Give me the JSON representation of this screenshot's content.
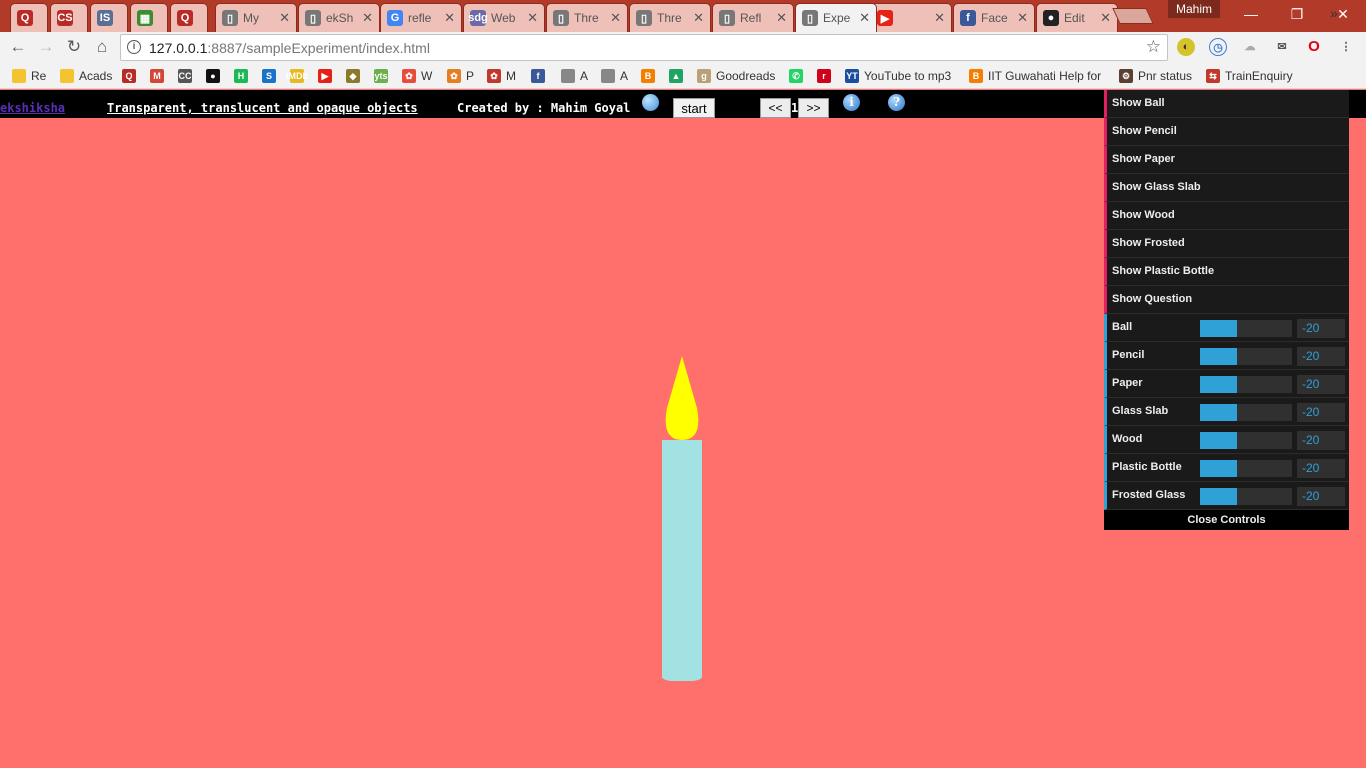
{
  "browser": {
    "tabs": [
      {
        "title": "",
        "icon": "quora-icon",
        "color": "#b92b27",
        "glyph": "Q"
      },
      {
        "title": "",
        "icon": "codechef-icon",
        "color": "#b92b27",
        "glyph": "CS"
      },
      {
        "title": "",
        "icon": "is-icon",
        "color": "#5b6f93",
        "glyph": "IS"
      },
      {
        "title": "",
        "icon": "grid-app-icon",
        "color": "#3c8d2f",
        "glyph": "▦"
      },
      {
        "title": "",
        "icon": "quora-icon",
        "color": "#b92b27",
        "glyph": "Q"
      },
      {
        "title": "My",
        "icon": "page-icon",
        "color": "#777777",
        "glyph": "▯"
      },
      {
        "title": "ekSh",
        "icon": "page-icon",
        "color": "#777777",
        "glyph": "▯"
      },
      {
        "title": "refle",
        "icon": "google-icon",
        "color": "#4285f4",
        "glyph": "G"
      },
      {
        "title": "Web",
        "icon": "sdg-icon",
        "color": "#6a6aa8",
        "glyph": "sdg"
      },
      {
        "title": "Thre",
        "icon": "page-icon",
        "color": "#777777",
        "glyph": "▯"
      },
      {
        "title": "Thre",
        "icon": "page-icon",
        "color": "#777777",
        "glyph": "▯"
      },
      {
        "title": "Refl",
        "icon": "page-icon",
        "color": "#777777",
        "glyph": "▯"
      },
      {
        "title": "Expe",
        "icon": "page-icon",
        "color": "#777777",
        "glyph": "▯"
      },
      {
        "title": "",
        "icon": "youtube-icon",
        "color": "#e62117",
        "glyph": "▶"
      },
      {
        "title": "Face",
        "icon": "facebook-icon",
        "color": "#3b5998",
        "glyph": "f"
      },
      {
        "title": "Edit",
        "icon": "github-icon",
        "color": "#222222",
        "glyph": "●"
      }
    ],
    "profile_name": "Mahim",
    "url_host": "127.0.0.1",
    "url_path": ":8887/sampleExperiment/index.html",
    "bookmarks": [
      {
        "label": "Re",
        "icon": "folder-icon",
        "color": "#f4c430",
        "glyph": ""
      },
      {
        "label": "Acads",
        "icon": "folder-icon",
        "color": "#f4c430",
        "glyph": ""
      },
      {
        "label": "",
        "icon": "quora-icon",
        "color": "#b92b27",
        "glyph": "Q"
      },
      {
        "label": "",
        "icon": "gmail-icon",
        "color": "#d44638",
        "glyph": "M"
      },
      {
        "label": "",
        "icon": "cc-icon",
        "color": "#555555",
        "glyph": "CC"
      },
      {
        "label": "",
        "icon": "github-icon",
        "color": "#111111",
        "glyph": "●"
      },
      {
        "label": "",
        "icon": "hackerearth-icon",
        "color": "#1db954",
        "glyph": "H"
      },
      {
        "label": "",
        "icon": "s-icon",
        "color": "#1a73c8",
        "glyph": "S"
      },
      {
        "label": "",
        "icon": "imdb-icon",
        "color": "#e6b91e",
        "glyph": "IMDb"
      },
      {
        "label": "",
        "icon": "youtube-icon",
        "color": "#e62117",
        "glyph": "▶"
      },
      {
        "label": "",
        "icon": "shield-icon",
        "color": "#8a7a2a",
        "glyph": "◆"
      },
      {
        "label": "",
        "icon": "yts-icon",
        "color": "#6ab04c",
        "glyph": "yts"
      },
      {
        "label": "W",
        "icon": "colorful-icon",
        "color": "#e74c3c",
        "glyph": "✿"
      },
      {
        "label": "P",
        "icon": "colorful-icon",
        "color": "#e67e22",
        "glyph": "✿"
      },
      {
        "label": "M",
        "icon": "colorful-icon",
        "color": "#c0392b",
        "glyph": "✿"
      },
      {
        "label": "",
        "icon": "facebook-icon",
        "color": "#3b5998",
        "glyph": "f"
      },
      {
        "label": "A",
        "icon": "page-icon",
        "color": "#888888",
        "glyph": ""
      },
      {
        "label": "A",
        "icon": "page-icon",
        "color": "#888888",
        "glyph": ""
      },
      {
        "label": "",
        "icon": "blogger-icon",
        "color": "#f57d00",
        "glyph": "B"
      },
      {
        "label": "",
        "icon": "drive-icon",
        "color": "#1fa463",
        "glyph": "▲"
      },
      {
        "label": "Goodreads",
        "icon": "goodreads-icon",
        "color": "#b9a27a",
        "glyph": "g"
      },
      {
        "label": "",
        "icon": "whatsapp-icon",
        "color": "#25d366",
        "glyph": "✆"
      },
      {
        "label": "",
        "icon": "r-icon",
        "color": "#d0021b",
        "glyph": "r"
      },
      {
        "label": "YouTube to mp3",
        "icon": "yt-mp3-icon",
        "color": "#1a4fa0",
        "glyph": "YT"
      },
      {
        "label": "IIT Guwahati Help for",
        "icon": "blogger-icon",
        "color": "#f57d00",
        "glyph": "B"
      },
      {
        "label": "Pnr status",
        "icon": "train-icon",
        "color": "#5a4030",
        "glyph": "⚙"
      },
      {
        "label": "TrainEnquiry",
        "icon": "train-enquiry-icon",
        "color": "#c0392b",
        "glyph": "⇆"
      }
    ]
  },
  "header": {
    "site_link": "ekshiksha",
    "experiment_title": "Transparent, translucent and opaque objects",
    "credit": "Created by : Mahim Goyal",
    "start_label": "start",
    "prev_label": "<<",
    "page_number": "1",
    "next_label": ">>"
  },
  "controls": {
    "toggles": [
      "Show Ball",
      "Show Pencil",
      "Show Paper",
      "Show Glass Slab",
      "Show Wood",
      "Show Frosted",
      "Show Plastic Bottle",
      "Show Question"
    ],
    "sliders": [
      {
        "label": "Ball",
        "value": "-20",
        "fill_fraction": 0.4
      },
      {
        "label": "Pencil",
        "value": "-20",
        "fill_fraction": 0.4
      },
      {
        "label": "Paper",
        "value": "-20",
        "fill_fraction": 0.4
      },
      {
        "label": "Glass Slab",
        "value": "-20",
        "fill_fraction": 0.4
      },
      {
        "label": "Wood",
        "value": "-20",
        "fill_fraction": 0.4
      },
      {
        "label": "Plastic Bottle",
        "value": "-20",
        "fill_fraction": 0.4
      },
      {
        "label": "Frosted Glass",
        "value": "-20",
        "fill_fraction": 0.4
      }
    ],
    "close_label": "Close Controls"
  },
  "scene": {
    "background_color": "#ff6f6b",
    "flame_color": "#ffff00",
    "candle_color": "#a3e2e2"
  }
}
